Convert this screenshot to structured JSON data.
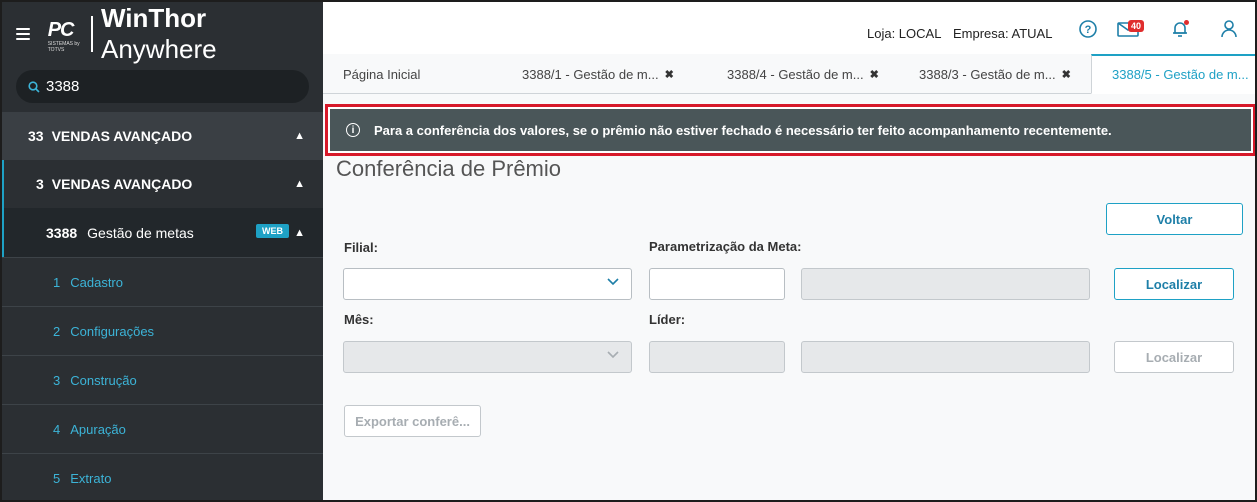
{
  "app": {
    "brand_logo": "PC",
    "brand_logo_sub": "SISTEMAS by TOTVS",
    "brand_bold": "WinThor",
    "brand_light": "Anywhere"
  },
  "search": {
    "value": "3388"
  },
  "sidebar": {
    "level1": {
      "num": "33",
      "label": "VENDAS AVANÇADO"
    },
    "level2": {
      "num": "3",
      "label": "VENDAS AVANÇADO"
    },
    "level3": {
      "num": "3388",
      "label": "Gestão de metas",
      "badge": "WEB"
    },
    "items": [
      {
        "num": "1",
        "label": "Cadastro"
      },
      {
        "num": "2",
        "label": "Configurações"
      },
      {
        "num": "3",
        "label": "Construção"
      },
      {
        "num": "4",
        "label": "Apuração"
      },
      {
        "num": "5",
        "label": "Extrato"
      }
    ]
  },
  "topbar": {
    "store": "Loja: LOCAL",
    "company": "Empresa: ATUAL",
    "mail_count": "40"
  },
  "tabs": [
    {
      "label": "Página Inicial"
    },
    {
      "label": "3388/1 - Gestão de m..."
    },
    {
      "label": "3388/4 - Gestão de m..."
    },
    {
      "label": "3388/3 - Gestão de m..."
    },
    {
      "label": "3388/5 - Gestão de m..."
    }
  ],
  "alert": {
    "text": "Para a conferência dos valores, se o prêmio não estiver fechado é necessário ter feito acompanhamento recentemente."
  },
  "main": {
    "title": "Conferência de Prêmio",
    "filial_label": "Filial:",
    "param_label": "Parametrização da Meta:",
    "mes_label": "Mês:",
    "lider_label": "Líder:",
    "voltar_label": "Voltar",
    "localizar_label": "Localizar",
    "localizar2_label": "Localizar",
    "exportar_label": "Exportar conferê..."
  },
  "colors": {
    "accent": "#1ea1c5",
    "sidebar_bg": "#2b2f33",
    "alert_bg": "#4a5659",
    "alert_border": "#d7192a"
  }
}
